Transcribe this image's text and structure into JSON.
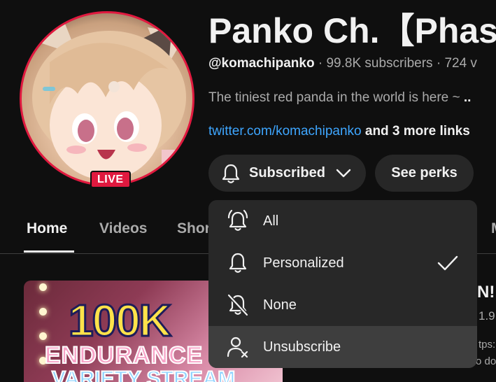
{
  "channel": {
    "title": "Panko Ch.【Phas",
    "handle": "@komachipanko",
    "separator1": " · ",
    "subscribers": "99.8K subscribers",
    "separator2": " · ",
    "videos": "724 v",
    "description": "The tiniest red panda in the world is here ~ ",
    "description_more": "..",
    "link": "twitter.com/komachipanko",
    "more_links": " and 3 more links",
    "live_badge": "LIVE"
  },
  "buttons": {
    "subscribed": "Subscribed",
    "see_perks": "See perks"
  },
  "tabs": [
    {
      "label": "Home",
      "active": true
    },
    {
      "label": "Videos"
    },
    {
      "label": "Shor"
    },
    {
      "label": "M"
    }
  ],
  "menu": {
    "items": [
      {
        "label": "All",
        "icon": "bell-ringing-icon"
      },
      {
        "label": "Personalized",
        "icon": "bell-icon",
        "checked": true
      },
      {
        "label": "None",
        "icon": "bell-off-icon"
      },
      {
        "label": "Unsubscribe",
        "icon": "person-remove-icon"
      }
    ]
  },
  "video": {
    "thumb_line1": "100K",
    "thumb_line2": "ENDURANCE",
    "thumb_line3": "VARIETY STREAM",
    "title_fragment": "N!",
    "views_fragment": "1.9",
    "desc_fragment1": "tps:",
    "desc_fragment2": "o do"
  },
  "colors": {
    "background": "#0f0f0f",
    "accent_red": "#e0193f",
    "link_blue": "#3ea6ff",
    "menu_bg": "#282828",
    "button_bg": "#272727"
  }
}
